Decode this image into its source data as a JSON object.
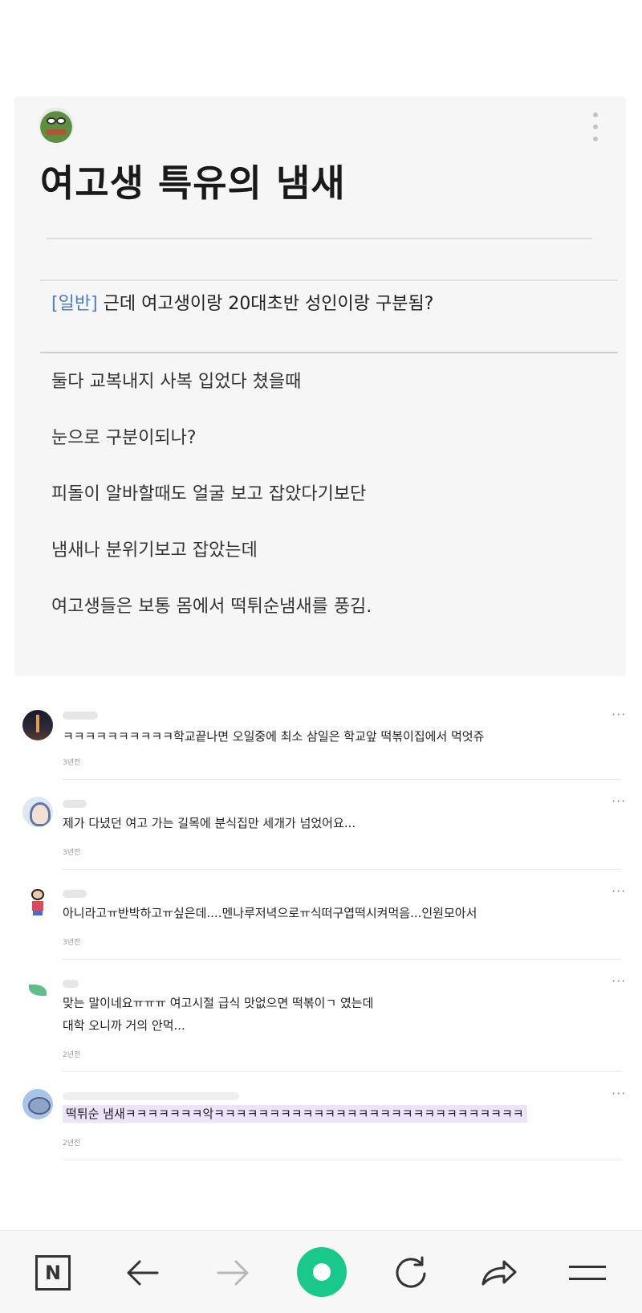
{
  "post": {
    "title": "여고생 특유의 냄새",
    "quote_tag": "[일반]",
    "quote_title": " 근데 여고생이랑 20대초반 성인이랑 구분됨?",
    "body": [
      "둘다 교복내지 사복 입었다 쳤을때",
      "눈으로 구분이되나?",
      "피돌이 알바할때도 얼굴 보고 잡았다기보단",
      "냄새나 분위기보고 잡았는데",
      "여고생들은 보통 몸에서 떡튀순냄새를 풍김."
    ]
  },
  "comments": [
    {
      "text": "ㅋㅋㅋㅋㅋㅋㅋㅋㅋㅋ학교끝나면 오일중에 최소 삼일은 학교앞 떡볶이집에서 먹엇쥬",
      "time": "3년전",
      "more": "···"
    },
    {
      "text": "제가 다녔던 여고 가는 길목에 분식집만 세개가 넘었어요...",
      "time": "3년전",
      "more": "···"
    },
    {
      "text": "아니라고ㅠ반박하고ㅠ싶은데....멘나루저녁으로ㅠ식떠구엽떡시켜먹음...인원모아서",
      "time": "3년전",
      "more": "···"
    },
    {
      "text": "맞는 말이네요ㅠㅠㅠ 여고시절 급식 맛없으면 떡볶이ㄱ 였는데",
      "text2": "대학 오니까 거의 안먹...",
      "time": "2년전",
      "more": "···"
    },
    {
      "text": "떡튀순 냄새ㅋㅋㅋㅋㅋㅋㅋ악ㅋㅋㅋㅋㅋㅋㅋㅋㅋㅋㅋㅋㅋㅋㅋㅋㅋㅋㅋㅋㅋㅋㅋㅋㅋㅋㅋㅋ",
      "time": "2년전",
      "more": "···"
    }
  ],
  "toolbar": {
    "home_label": "N",
    "icons": [
      "naver-home-icon",
      "back-arrow-icon",
      "forward-arrow-icon",
      "green-dot-icon",
      "refresh-icon",
      "share-icon",
      "menu-icon"
    ]
  },
  "colors": {
    "tag_blue": "#4a7fc1",
    "highlight_purple": "#ece4fb",
    "green_button": "#19c98a"
  }
}
